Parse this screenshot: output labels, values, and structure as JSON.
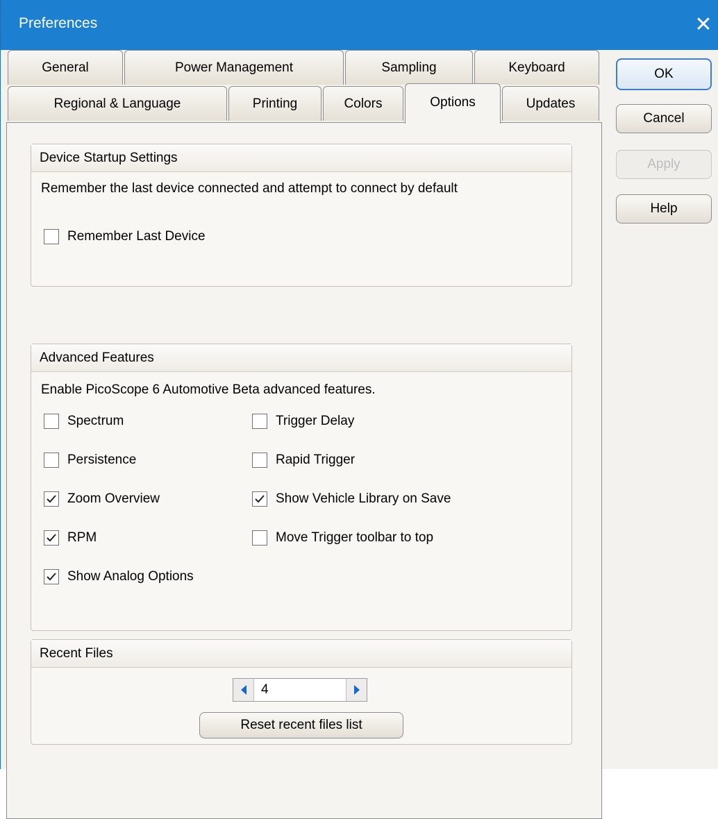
{
  "window": {
    "title": "Preferences"
  },
  "tabs": {
    "row1": [
      "General",
      "Power Management",
      "Sampling",
      "Keyboard"
    ],
    "row2": [
      "Regional & Language",
      "Printing",
      "Colors",
      "Options",
      "Updates"
    ],
    "active": "Options"
  },
  "device_startup": {
    "header": "Device Startup Settings",
    "description": "Remember the last device connected and attempt to connect by default",
    "remember_last_device": {
      "label": "Remember Last Device",
      "checked": false
    }
  },
  "advanced": {
    "header": "Advanced Features",
    "description": "Enable PicoScope 6 Automotive Beta advanced features.",
    "left": [
      {
        "label": "Spectrum",
        "checked": false
      },
      {
        "label": "Persistence",
        "checked": false
      },
      {
        "label": "Zoom Overview",
        "checked": true
      },
      {
        "label": "RPM",
        "checked": true
      },
      {
        "label": "Show Analog Options",
        "checked": true
      }
    ],
    "right": [
      {
        "label": "Trigger Delay",
        "checked": false
      },
      {
        "label": "Rapid Trigger",
        "checked": false
      },
      {
        "label": "Show Vehicle Library on Save",
        "checked": true
      },
      {
        "label": "Move Trigger toolbar to top",
        "checked": false
      }
    ]
  },
  "recent_files": {
    "header": "Recent Files",
    "count": "4",
    "reset_label": "Reset recent files list"
  },
  "buttons": {
    "ok": "OK",
    "cancel": "Cancel",
    "apply": "Apply",
    "help": "Help"
  },
  "colors": {
    "titlebar": "#1c7fd0",
    "dialog_bg": "#f4f2ee",
    "default_button_border": "#3c7fd0",
    "spin_arrow": "#1c66c4"
  }
}
